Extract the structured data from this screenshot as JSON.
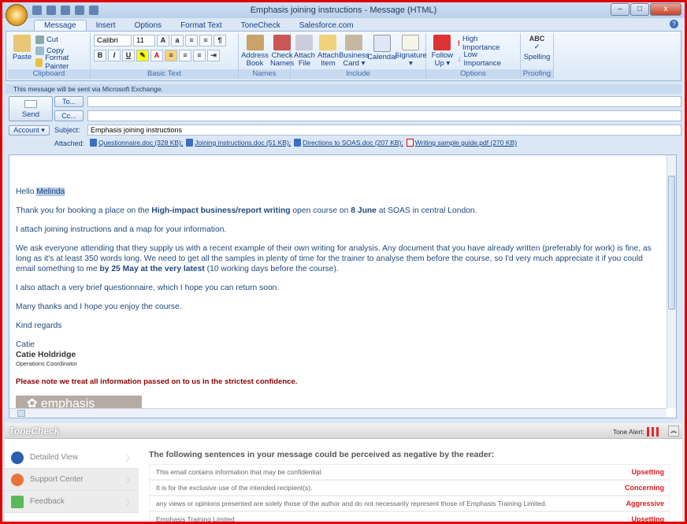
{
  "window": {
    "title": "Emphasis joining instructions - Message (HTML)",
    "min": "–",
    "max": "□",
    "close": "x"
  },
  "tabs": [
    "Message",
    "Insert",
    "Options",
    "Format Text",
    "ToneCheck",
    "Salesforce.com"
  ],
  "ribbon": {
    "clipboard": {
      "paste": "Paste",
      "cut": "Cut",
      "copy": "Copy",
      "format_painter": "Format Painter",
      "label": "Clipboard"
    },
    "basic_text": {
      "font": "Calibri",
      "size": "11",
      "label": "Basic Text"
    },
    "names": {
      "address_book": "Address Book",
      "check_names": "Check Names",
      "label": "Names"
    },
    "include": {
      "attach_file": "Attach File",
      "attach_item": "Attach Item",
      "business_card": "Business Card ▾",
      "calendar": "Calendar",
      "signature": "Signature ▾",
      "label": "Include"
    },
    "options": {
      "follow_up": "Follow Up ▾",
      "high": "High Importance",
      "low": "Low Importance",
      "label": "Options"
    },
    "proofing": {
      "spelling": "Spelling",
      "label": "Proofing"
    }
  },
  "info_bar": "This message will be sent via Microsoft Exchange.",
  "form": {
    "send": "Send",
    "to": "To...",
    "cc": "Cc...",
    "account": "Account ▾",
    "subject_label": "Subject:",
    "subject": "Emphasis joining instructions",
    "attached_label": "Attached:",
    "attachments": [
      {
        "name": "Questionnaire.doc (328 KB);",
        "type": "doc"
      },
      {
        "name": "Joining instructions.doc (51 KB);",
        "type": "doc"
      },
      {
        "name": "Directions to SOAS.doc (207 KB);",
        "type": "doc"
      },
      {
        "name": "Writing sample guide.pdf (270 KB)",
        "type": "pdf"
      }
    ]
  },
  "body": {
    "greeting": "Hello ",
    "name": "Melinda",
    "p1a": "Thank you for booking a place on the ",
    "p1b": "High-impact business/report writing",
    "p1c": " open course on ",
    "p1d": "8 June",
    "p1e": " at SOAS in central London.",
    "p2": "I attach joining instructions and a map for your information.",
    "p3a": "We ask everyone attending that they supply us with a recent example of their own writing for analysis. Any document that you have already written (preferably for work) is fine, as long as it's at least 350 words long. We need to get all the samples in plenty of time for the trainer to analyse them before the course, so I'd very much appreciate it if you could email something to me ",
    "p3b": "by 25 May at the very latest",
    "p3c": " (10 working days before the course).",
    "p4": "I also attach a very brief questionnaire, which I hope you can return soon.",
    "p5": "Many thanks and I hope you enjoy the course.",
    "p6": "Kind regards",
    "sig1": "Catie",
    "sig2": "Catie Holdridge",
    "sig3": "Operations Coordinator",
    "notice": "Please note we treat all information passed on to us in the strictest confidence.",
    "logo": "emphasis"
  },
  "tonecheck": {
    "logo": "ToneCheck",
    "alert_label": "Tone Alert:",
    "nav": [
      "Detailed View",
      "Support Center",
      "Feedback"
    ],
    "heading": "The following sentences in your message could be perceived as negative by the reader:",
    "rows": [
      {
        "text": "This email contains information that may be confidential.",
        "tone": "Upsetting"
      },
      {
        "text": "It is for the exclusive use of the intended recipient(s).",
        "tone": "Concerning"
      },
      {
        "text": "any views or opinions presented are solely those of the author and do not necessarily represent those of Emphasis Training Limited.",
        "tone": "Aggressive"
      },
      {
        "text": "Emphasis Training Limited",
        "tone": "Upsetting"
      }
    ]
  },
  "colors": {
    "accent": "#15428b",
    "body_text": "#1f497d",
    "alert": "#e01b1b",
    "notice": "#8b0000"
  }
}
